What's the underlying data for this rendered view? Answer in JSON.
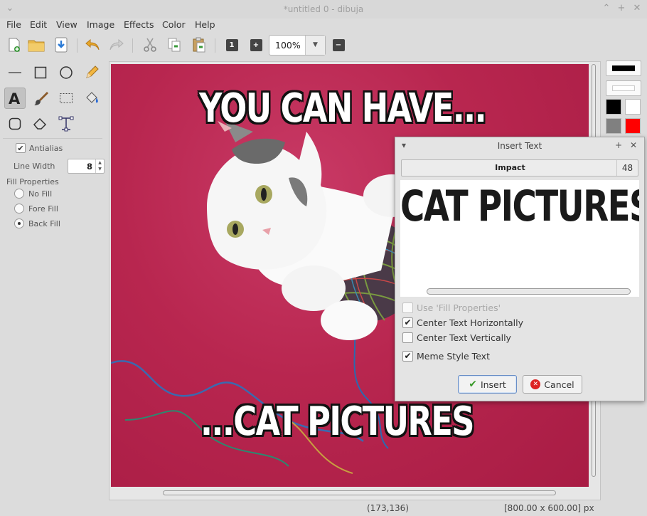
{
  "window": {
    "title": "*untitled 0 - dibuja",
    "menu_icon": "chevron-down-icon",
    "controls": [
      "chevron-up-icon",
      "maximize-icon",
      "close-icon"
    ]
  },
  "menu": [
    "File",
    "Edit",
    "View",
    "Image",
    "Effects",
    "Color",
    "Help"
  ],
  "toolbar": {
    "buttons": [
      "new-file-icon",
      "open-folder-icon",
      "save-download-icon",
      "undo-icon",
      "redo-icon",
      "cut-icon",
      "copy-icon",
      "paste-icon"
    ],
    "zoom_btn_1": "1",
    "zoom_btn_plus": "+",
    "zoom_value": "100%",
    "zoom_btn_minus": "−"
  },
  "tools": {
    "items": [
      "line-icon",
      "rectangle-icon",
      "ellipse-icon",
      "pencil-icon",
      "text-icon",
      "brush-icon",
      "selection-icon",
      "fill-bucket-icon",
      "rounded-rect-icon",
      "eraser-icon",
      "crop-transform-icon"
    ],
    "active": "text-icon"
  },
  "properties": {
    "antialias_label": "Antialias",
    "antialias_checked": true,
    "line_width_label": "Line Width",
    "line_width_value": "8",
    "fill_properties_label": "Fill Properties",
    "fill_options": [
      "No Fill",
      "Fore Fill",
      "Back Fill"
    ],
    "fill_selected": "Back Fill"
  },
  "canvas": {
    "top_text": "YOU CAN HAVE...",
    "bottom_text": "...CAT PICTURES",
    "background": "#b8264f"
  },
  "colors": {
    "stroke_preview": "#000000",
    "fill_preview": "#ffffff",
    "swatches": [
      "#000000",
      "#ffffff",
      "#808080",
      "#ff0000"
    ]
  },
  "dialog": {
    "title": "Insert Text",
    "font_name": "Impact",
    "font_size": "48",
    "preview_text": "CAT PICTURES",
    "options": [
      {
        "label": "Use 'Fill Properties'",
        "checked": false,
        "disabled": true
      },
      {
        "label": "Center Text Horizontally",
        "checked": true,
        "disabled": false
      },
      {
        "label": "Center Text Vertically",
        "checked": false,
        "disabled": false
      },
      {
        "label": "Meme Style Text",
        "checked": true,
        "disabled": false
      }
    ],
    "insert_label": "Insert",
    "cancel_label": "Cancel"
  },
  "status": {
    "cursor": "(173,136)",
    "size": "[800.00 x 600.00] px"
  }
}
